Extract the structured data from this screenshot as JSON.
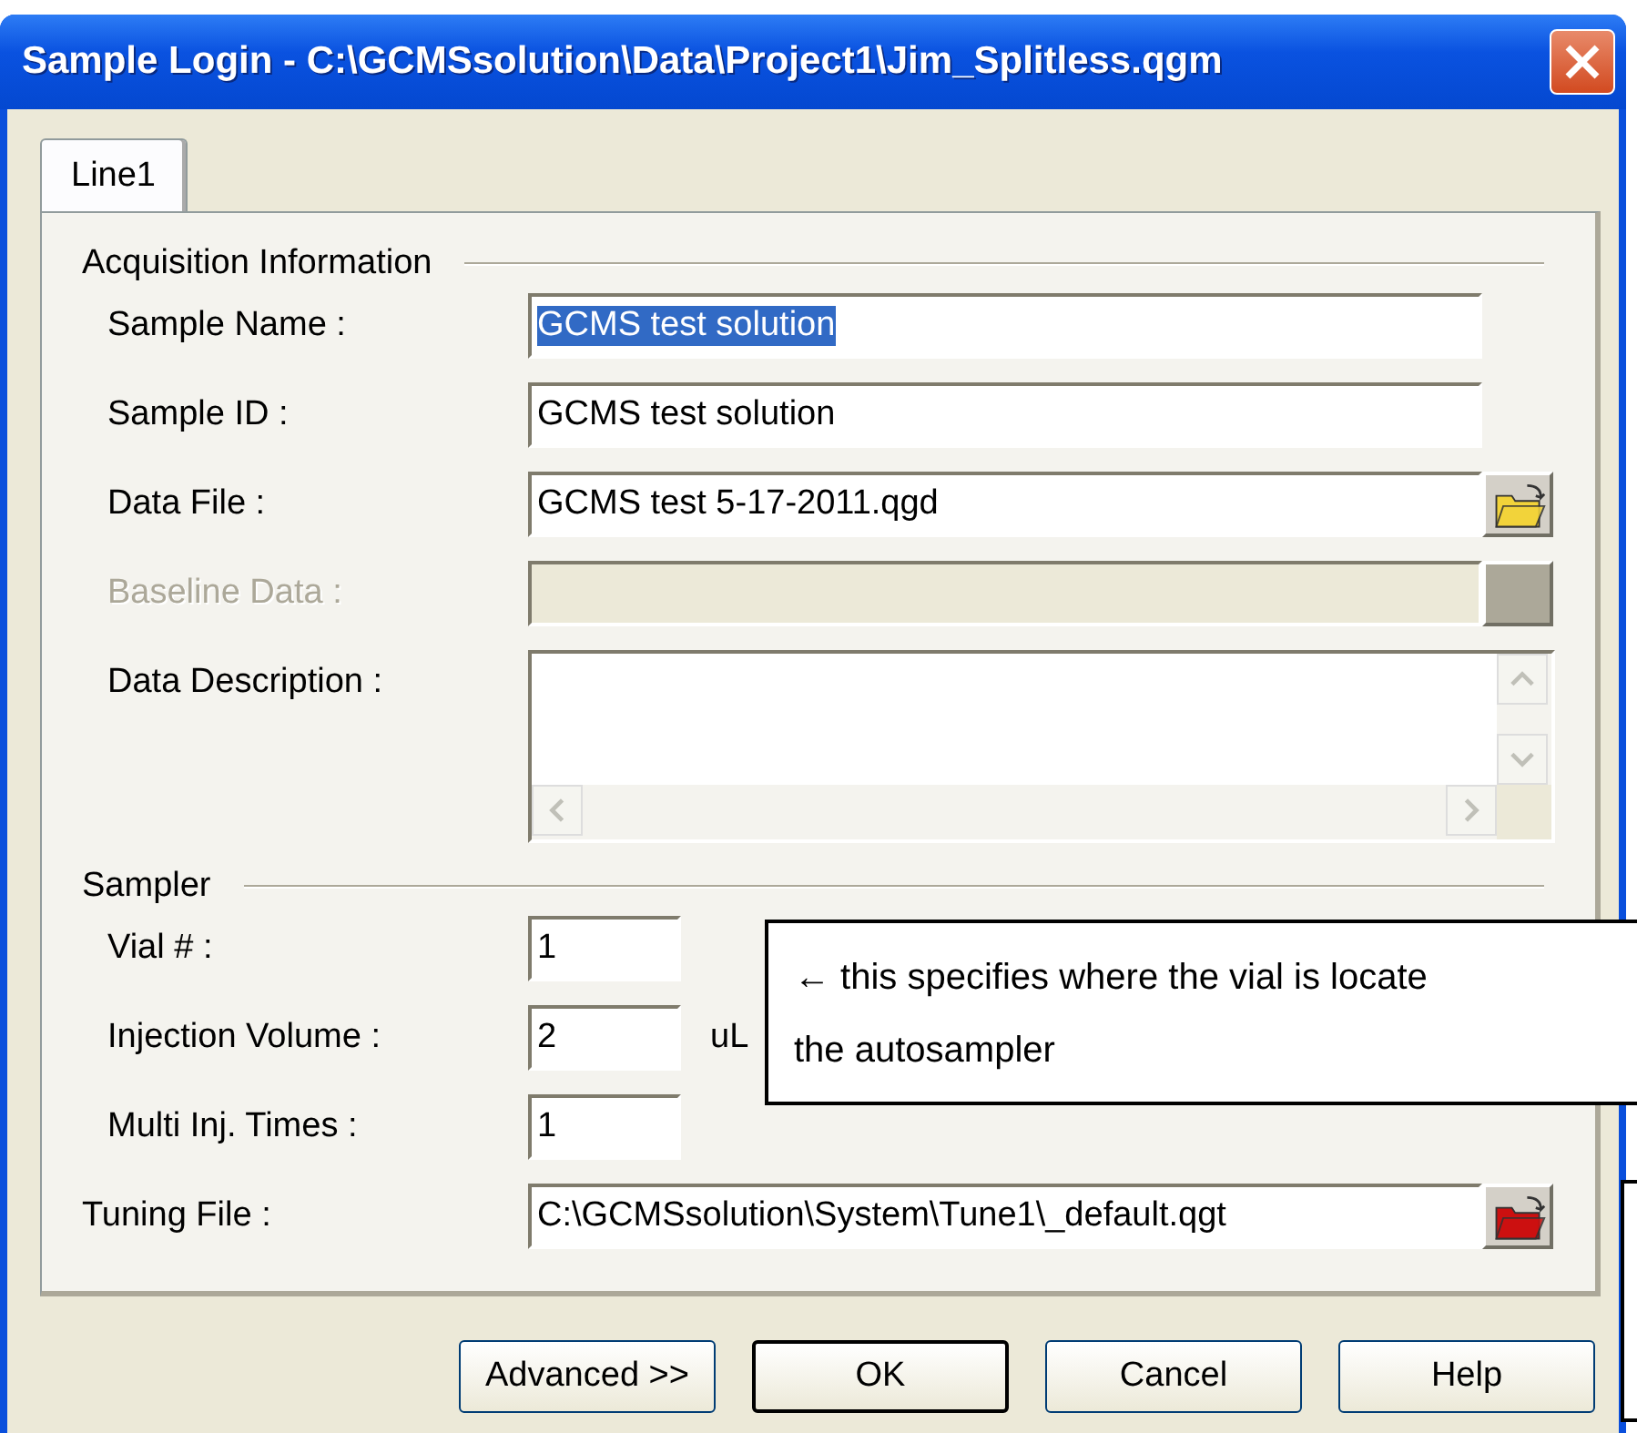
{
  "window": {
    "title": "Sample Login - C:\\GCMSsolution\\Data\\Project1\\Jim_Splitless.qgm"
  },
  "tabs": [
    {
      "label": "Line1",
      "selected": true
    }
  ],
  "acquisition": {
    "heading": "Acquisition Information",
    "fields": [
      {
        "kind": "text",
        "label": "Sample Name :",
        "value": "GCMS test solution",
        "highlighted": true,
        "disabled": false
      },
      {
        "kind": "text",
        "label": "Sample ID :",
        "value": "GCMS test solution",
        "highlighted": false,
        "disabled": false
      },
      {
        "kind": "file",
        "label": "Data File :",
        "value": "GCMS test 5-17-2011.qgd",
        "highlighted": false,
        "disabled": false,
        "color": "#f2d33a"
      },
      {
        "kind": "file",
        "label": "Baseline Data :",
        "disabled": true
      },
      {
        "kind": "memo",
        "label": "Data Description :",
        "disabled": false
      }
    ]
  },
  "sampler": {
    "heading": "Sampler",
    "fields": [
      {
        "kind": "number",
        "label": "Vial # :",
        "value": "1",
        "disabled": false
      },
      {
        "kind": "number",
        "label": "Injection Volume :",
        "value": "2",
        "unit": "uL",
        "disabled": false
      },
      {
        "kind": "number",
        "label": "Multi Inj. Times :",
        "value": "1",
        "disabled": false
      }
    ]
  },
  "tuning": {
    "kind": "file",
    "label": "Tuning File :",
    "value": "C:\\GCMSsolution\\System\\Tune1\\_default.qgt",
    "disabled": false,
    "color": "#cc1010"
  },
  "buttons": [
    {
      "label": "Advanced >>",
      "default": false
    },
    {
      "label": "OK",
      "default": true
    },
    {
      "label": "Cancel",
      "default": false
    },
    {
      "label": "Help",
      "default": false
    }
  ],
  "callouts": [
    {
      "kind": "text",
      "lines": [
        "← this specifies where the vial is locate",
        "the autosampler"
      ]
    },
    {
      "kind": "blank"
    }
  ]
}
